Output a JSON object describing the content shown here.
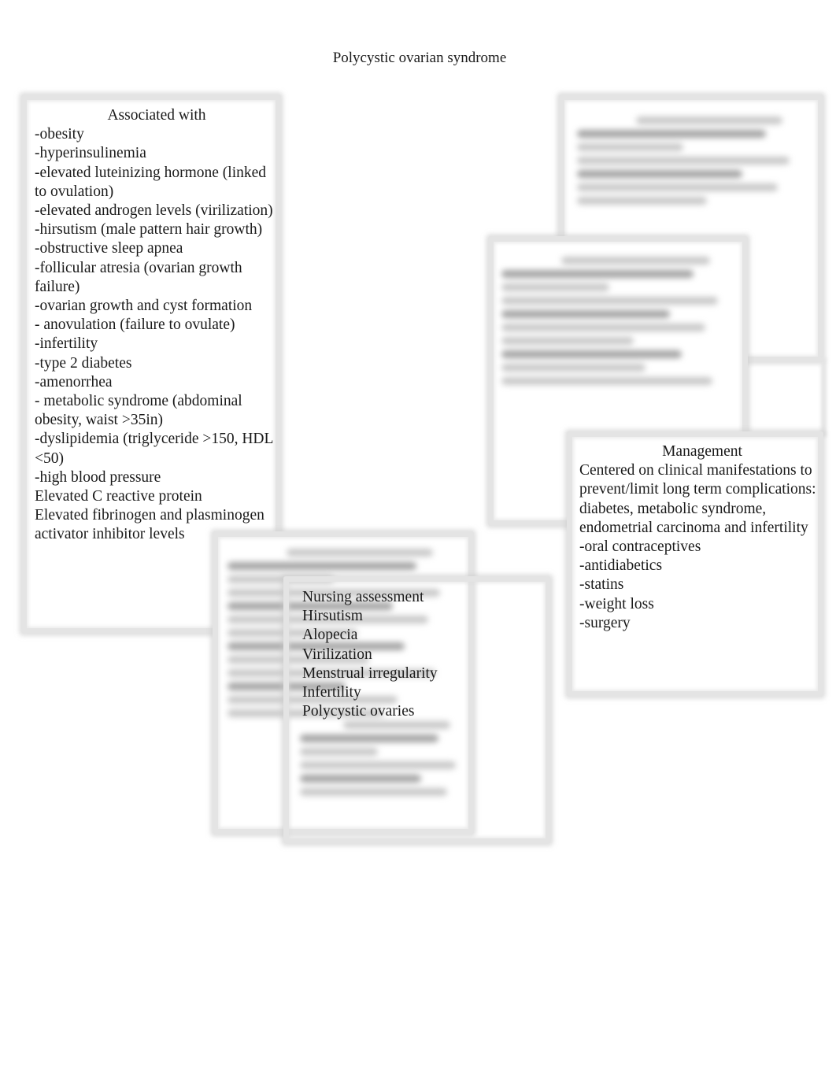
{
  "page": {
    "title": "Polycystic ovarian syndrome"
  },
  "associated_with": {
    "heading": "Associated with",
    "items": [
      "-obesity",
      "-hyperinsulinemia",
      "-elevated luteinizing hormone (linked to ovulation)",
      "-elevated androgen levels (virilization)",
      "-hirsutism (male pattern hair growth)",
      "-obstructive sleep apnea",
      "-follicular atresia (ovarian growth failure)",
      "-ovarian growth and cyst formation",
      "- anovulation (failure to ovulate)",
      "-infertility",
      "-type 2 diabetes",
      "-amenorrhea",
      "- metabolic syndrome (abdominal obesity, waist >35in)",
      "-dyslipidemia (triglyceride >150, HDL <50)",
      "-high blood pressure",
      "Elevated C reactive protein",
      "Elevated fibrinogen and plasminogen activator inhibitor levels"
    ]
  },
  "management": {
    "heading": "Management",
    "items": [
      "Centered on clinical manifestations to prevent/limit long term complications: diabetes, metabolic syndrome, endometrial carcinoma and infertility",
      "-oral contraceptives",
      "-antidiabetics",
      "-statins",
      "-weight loss",
      "-surgery"
    ]
  },
  "nursing_assessment": {
    "heading": "Nursing assessment",
    "items": [
      "Hirsutism",
      "Alopecia",
      "Virilization",
      "Menstrual irregularity",
      "Infertility",
      "Polycystic ovaries"
    ]
  },
  "obscured_boxes": {
    "top_right": {
      "line_count": 7
    },
    "middle_right": {
      "line_count": 10
    },
    "middle_bottom": {
      "line_count": 13
    },
    "nursing_tail": {
      "line_count": 6
    }
  }
}
